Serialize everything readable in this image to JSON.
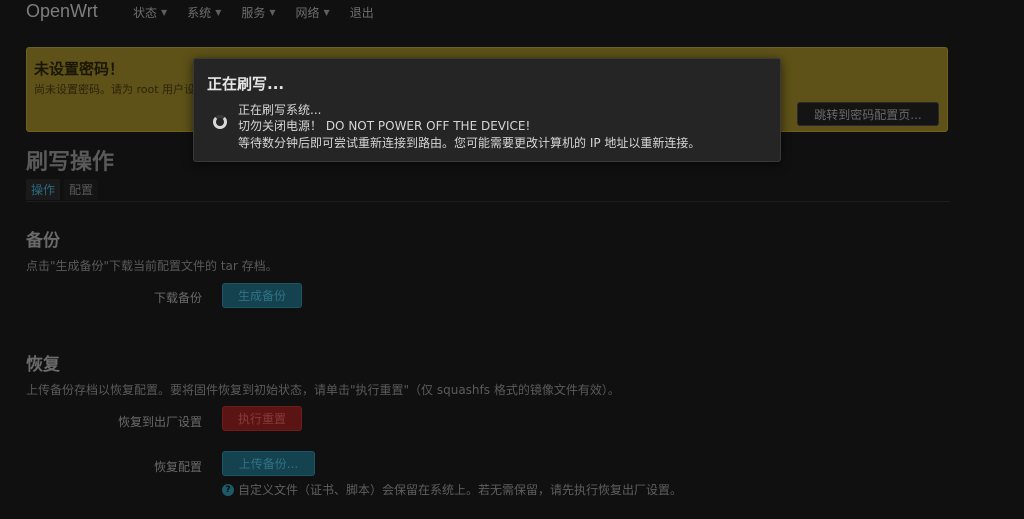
{
  "navbar": {
    "brand": "OpenWrt",
    "menu": [
      {
        "label": "状态",
        "caret": "▼"
      },
      {
        "label": "系统",
        "caret": "▼"
      },
      {
        "label": "服务",
        "caret": "▼"
      },
      {
        "label": "网络",
        "caret": "▼"
      },
      {
        "label": "退出",
        "caret": ""
      }
    ]
  },
  "alert": {
    "title": "未设置密码！",
    "text": "尚未设置密码。请为 root 用户设置密码以保护主机并开启 SSH。",
    "button": "跳转到密码配置页..."
  },
  "page": {
    "title": "刷写操作",
    "tabs": [
      "操作",
      "配置"
    ]
  },
  "backup": {
    "title": "备份",
    "desc": "点击\"生成备份\"下载当前配置文件的 tar 存档。",
    "row_label": "下载备份",
    "button": "生成备份"
  },
  "restore": {
    "title": "恢复",
    "desc": "上传备份存档以恢复配置。要将固件恢复到初始状态，请单击\"执行重置\"（仅 squashfs 格式的镜像文件有效）。",
    "factory_label": "恢复到出厂设置",
    "factory_button": "执行重置",
    "restore_label": "恢复配置",
    "restore_button": "上传备份...",
    "hint_icon": "?",
    "hint": "自定义文件（证书、脚本）会保留在系统上。若无需保留，请先执行恢复出厂设置。"
  },
  "modal": {
    "title": "正在刷写...",
    "line1": "正在刷写系统...",
    "line2": "切勿关闭电源！ DO NOT POWER OFF THE DEVICE!",
    "line3": "等待数分钟后即可尝试重新连接到路由。您可能需要更改计算机的 IP 地址以重新连接。"
  }
}
